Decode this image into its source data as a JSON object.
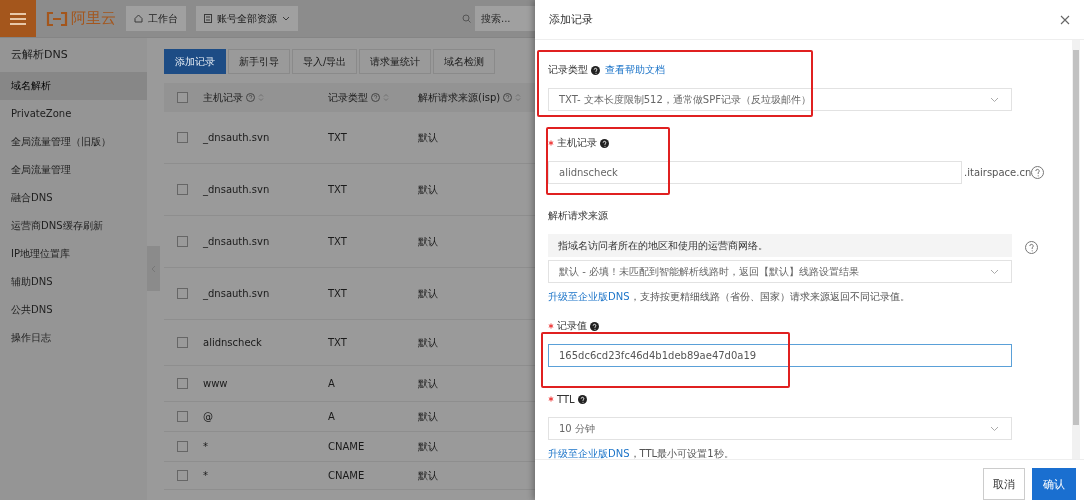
{
  "topbar": {
    "logo": "阿里云",
    "workbench": "工作台",
    "resources": "账号全部资源",
    "search": {
      "placeholder": "搜索..."
    }
  },
  "sidebar": {
    "title": "云解析DNS",
    "items": [
      {
        "label": "域名解析",
        "selected": true
      },
      {
        "label": "PrivateZone",
        "selected": false
      },
      {
        "label": "全局流量管理（旧版）",
        "selected": false
      },
      {
        "label": "全局流量管理",
        "selected": false
      },
      {
        "label": "融合DNS",
        "selected": false
      },
      {
        "label": "运营商DNS缓存刷新",
        "selected": false
      },
      {
        "label": "IP地理位置库",
        "selected": false
      },
      {
        "label": "辅助DNS",
        "selected": false
      },
      {
        "label": "公共DNS",
        "selected": false
      },
      {
        "label": "操作日志",
        "selected": false
      }
    ]
  },
  "toolbar": [
    {
      "label": "添加记录",
      "primary": true
    },
    {
      "label": "新手引导",
      "primary": false
    },
    {
      "label": "导入/导出",
      "primary": false
    },
    {
      "label": "请求量统计",
      "primary": false
    },
    {
      "label": "域名检测",
      "primary": false
    }
  ],
  "table": {
    "all_checked": false,
    "columns": [
      "主机记录",
      "记录类型",
      "解析请求来源(isp)"
    ],
    "rows": [
      {
        "host": "_dnsauth.svn",
        "type": "TXT",
        "isp": "默认",
        "checked": false
      },
      {
        "host": "_dnsauth.svn",
        "type": "TXT",
        "isp": "默认",
        "checked": false
      },
      {
        "host": "_dnsauth.svn",
        "type": "TXT",
        "isp": "默认",
        "checked": false
      },
      {
        "host": "_dnsauth.svn",
        "type": "TXT",
        "isp": "默认",
        "checked": false
      },
      {
        "host": "alidnscheck",
        "type": "TXT",
        "isp": "默认",
        "checked": false
      },
      {
        "host": "www",
        "type": "A",
        "isp": "默认",
        "checked": false
      },
      {
        "host": "@",
        "type": "A",
        "isp": "默认",
        "checked": false
      },
      {
        "host": "*",
        "type": "CNAME",
        "isp": "默认",
        "checked": false
      },
      {
        "host": "*",
        "type": "CNAME",
        "isp": "默认",
        "checked": false
      }
    ]
  },
  "drawer": {
    "title": "添加记录",
    "fields": [
      {
        "kind": "select",
        "label": "记录类型",
        "required": false,
        "help": true,
        "link": "查看帮助文档",
        "value": "TXT- 文本长度限制512，通常做SPF记录（反垃圾邮件）",
        "highlighted": true
      },
      {
        "kind": "input",
        "label": "主机记录",
        "required": true,
        "help": true,
        "value": "alidnscheck",
        "suffix": ".itairspace.cn",
        "focused": false,
        "highlighted": true
      },
      {
        "kind": "select",
        "label": "解析请求来源",
        "required": false,
        "help": false,
        "info": "指域名访问者所在的地区和使用的运营商网络。",
        "value": "默认 - 必填！未匹配到智能解析线路时，返回【默认】线路设置结果",
        "note_link": "升级至企业版DNS",
        "note": "，支持按更精细线路（省份、国家）请求来源返回不同记录值。",
        "highlighted": false
      },
      {
        "kind": "input",
        "label": "记录值",
        "required": true,
        "help": true,
        "value": "165dc6cd23fc46d4b1deb89ae47d0a19",
        "focused": true,
        "highlighted": true
      },
      {
        "kind": "select",
        "label": "TTL",
        "required": true,
        "help": true,
        "value": "10 分钟",
        "note_link": "升级至企业版DNS",
        "note": "，TTL最小可设置1秒。",
        "highlighted": false
      }
    ],
    "buttons": [
      {
        "label": "取消",
        "primary": false
      },
      {
        "label": "确认",
        "primary": true
      }
    ]
  }
}
